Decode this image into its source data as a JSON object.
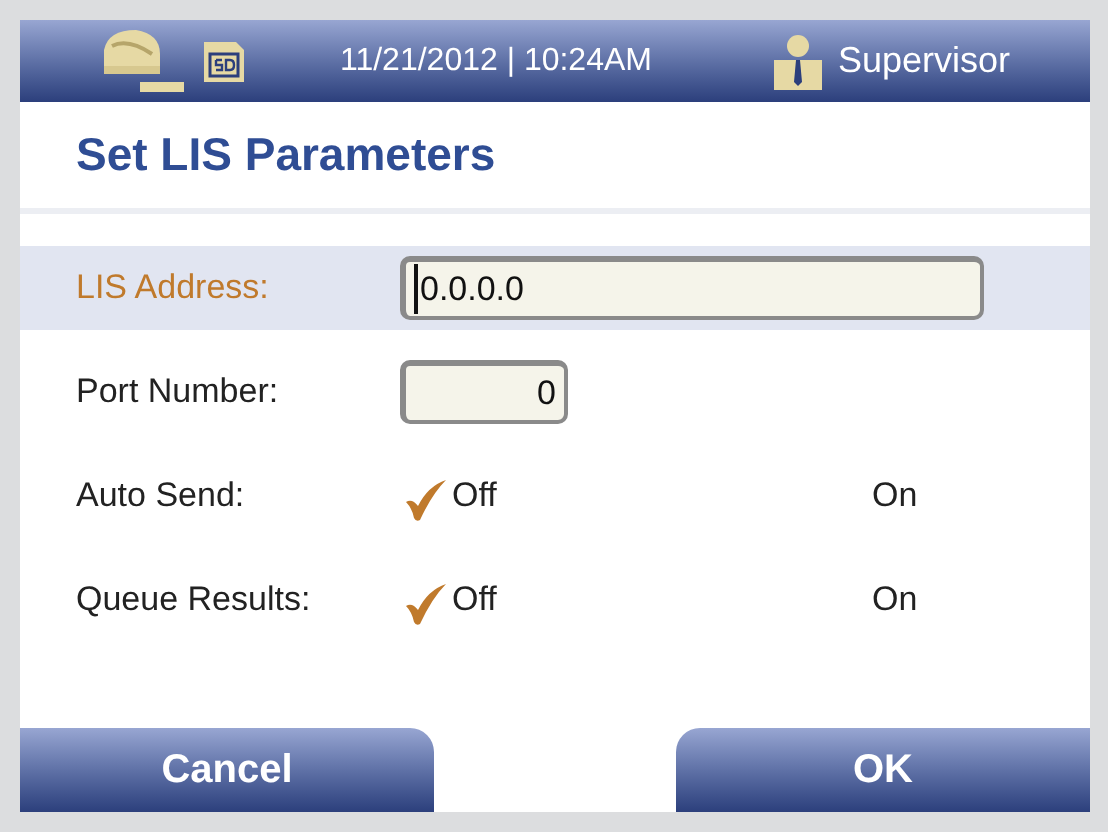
{
  "status_bar": {
    "date_time": "11/21/2012 | 10:24AM",
    "user": "Supervisor"
  },
  "title": "Set LIS Parameters",
  "fields": [
    {
      "kind": "text",
      "label": "LIS Address:",
      "value": "0.0.0.0",
      "focused": true
    },
    {
      "kind": "number",
      "label": "Port Number:",
      "value": "0",
      "focused": false
    },
    {
      "kind": "choice",
      "label": "Auto Send:",
      "focused": false,
      "options": [
        {
          "label": "Off",
          "selected": true
        },
        {
          "label": "On",
          "selected": false
        }
      ]
    },
    {
      "kind": "choice",
      "label": "Queue Results:",
      "focused": false,
      "options": [
        {
          "label": "Off",
          "selected": true
        },
        {
          "label": "On",
          "selected": false
        }
      ]
    }
  ],
  "buttons": [
    {
      "label": "Cancel"
    },
    {
      "label": "OK"
    }
  ]
}
